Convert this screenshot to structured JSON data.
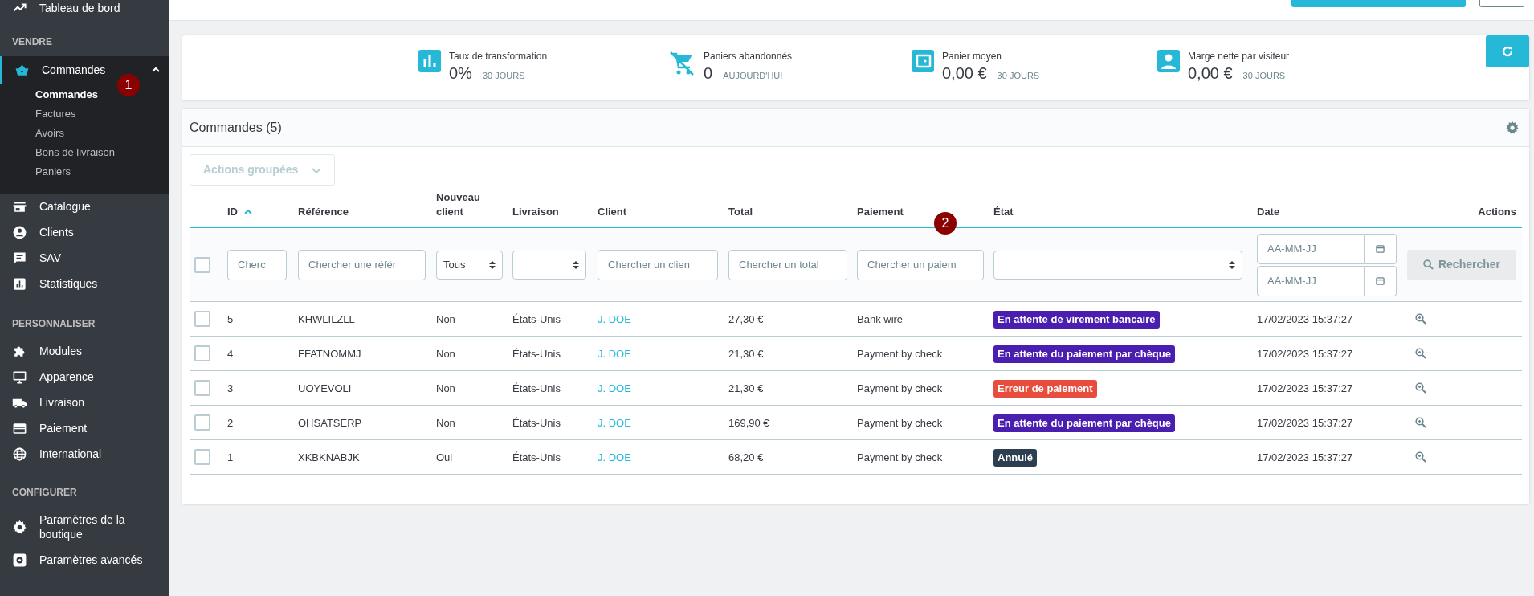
{
  "sidebar": {
    "top_item": {
      "label": "Tableau de bord"
    },
    "sections": [
      {
        "title": "VENDRE",
        "items": [
          {
            "label": "Commandes",
            "selected": true,
            "expanded": true,
            "children": [
              {
                "label": "Commandes",
                "selected": true
              },
              {
                "label": "Factures",
                "selected": false
              },
              {
                "label": "Avoirs",
                "selected": false
              },
              {
                "label": "Bons de livraison",
                "selected": false
              },
              {
                "label": "Paniers",
                "selected": false
              }
            ]
          },
          {
            "label": "Catalogue",
            "selected": false
          },
          {
            "label": "Clients",
            "selected": false
          },
          {
            "label": "SAV",
            "selected": false
          },
          {
            "label": "Statistiques",
            "selected": false
          }
        ]
      },
      {
        "title": "PERSONNALISER",
        "items": [
          {
            "label": "Modules",
            "selected": false
          },
          {
            "label": "Apparence",
            "selected": false
          },
          {
            "label": "Livraison",
            "selected": false
          },
          {
            "label": "Paiement",
            "selected": false
          },
          {
            "label": "International",
            "selected": false
          }
        ]
      },
      {
        "title": "CONFIGURER",
        "items": [
          {
            "label": "Paramètres de la boutique",
            "selected": false
          },
          {
            "label": "Paramètres avancés",
            "selected": false
          }
        ]
      }
    ]
  },
  "kpis": [
    {
      "label": "Taux de transformation",
      "value": "0%",
      "period": "30 JOURS"
    },
    {
      "label": "Paniers abandonnés",
      "value": "0",
      "period": "AUJOURD'HUI"
    },
    {
      "label": "Panier moyen",
      "value": "0,00 €",
      "period": "30 JOURS"
    },
    {
      "label": "Marge nette par visiteur",
      "value": "0,00 €",
      "period": "30 JOURS"
    }
  ],
  "orders": {
    "title": "Commandes (5)",
    "bulk_actions": {
      "label": "Actions groupées",
      "disabled": true
    },
    "columns": [
      {
        "label": "ID",
        "sorted": true
      },
      {
        "label": "Référence",
        "sorted": false
      },
      {
        "label": "Nouveau client",
        "sorted": false
      },
      {
        "label": "Livraison",
        "sorted": false
      },
      {
        "label": "Client",
        "sorted": false
      },
      {
        "label": "Total",
        "sorted": false
      },
      {
        "label": "Paiement",
        "sorted": false
      },
      {
        "label": "État",
        "sorted": false
      },
      {
        "label": "Date",
        "sorted": false
      },
      {
        "label": "Actions",
        "sorted": false
      }
    ],
    "filters": [
      {
        "kind": "checkbox",
        "checked": false
      },
      {
        "kind": "text",
        "placeholder": "Cherc"
      },
      {
        "kind": "text",
        "placeholder": "Chercher une référ"
      },
      {
        "kind": "select",
        "value": "Tous"
      },
      {
        "kind": "select"
      },
      {
        "kind": "text",
        "placeholder": "Chercher un clien"
      },
      {
        "kind": "text",
        "placeholder": "Chercher un total"
      },
      {
        "kind": "text",
        "placeholder": "Chercher un paiem"
      },
      {
        "kind": "select"
      },
      {
        "kind": "daterange",
        "from_placeholder": "AA-MM-JJ",
        "to_placeholder": "AA-MM-JJ"
      },
      {
        "kind": "button",
        "label": "Rechercher",
        "disabled": true
      }
    ],
    "rows": [
      {
        "checked": false,
        "id": "5",
        "reference": "KHWLILZLL",
        "new_client": "Non",
        "delivery": "États-Unis",
        "customer": "J. DOE",
        "total": "27,30 €",
        "payment": "Bank wire",
        "state": {
          "label": "En attente de virement bancaire",
          "color": "#4a1fb0"
        },
        "date": "17/02/2023 15:37:27"
      },
      {
        "checked": false,
        "id": "4",
        "reference": "FFATNOMMJ",
        "new_client": "Non",
        "delivery": "États-Unis",
        "customer": "J. DOE",
        "total": "21,30 €",
        "payment": "Payment by check",
        "state": {
          "label": "En attente du paiement par chèque",
          "color": "#4a1fb0"
        },
        "date": "17/02/2023 15:37:27"
      },
      {
        "checked": false,
        "id": "3",
        "reference": "UOYEVOLI",
        "new_client": "Non",
        "delivery": "États-Unis",
        "customer": "J. DOE",
        "total": "21,30 €",
        "payment": "Payment by check",
        "state": {
          "label": "Erreur de paiement",
          "color": "#e74c3c"
        },
        "date": "17/02/2023 15:37:27"
      },
      {
        "checked": false,
        "id": "2",
        "reference": "OHSATSERP",
        "new_client": "Non",
        "delivery": "États-Unis",
        "customer": "J. DOE",
        "total": "169,90 €",
        "payment": "Payment by check",
        "state": {
          "label": "En attente du paiement par chèque",
          "color": "#4a1fb0"
        },
        "date": "17/02/2023 15:37:27"
      },
      {
        "checked": false,
        "id": "1",
        "reference": "XKBKNABJK",
        "new_client": "Oui",
        "delivery": "États-Unis",
        "customer": "J. DOE",
        "total": "68,20 €",
        "payment": "Payment by check",
        "state": {
          "label": "Annulé",
          "color": "#2c3e50"
        },
        "date": "17/02/2023 15:37:27"
      }
    ]
  },
  "annotations": [
    {
      "number": "1"
    },
    {
      "number": "2"
    }
  ]
}
